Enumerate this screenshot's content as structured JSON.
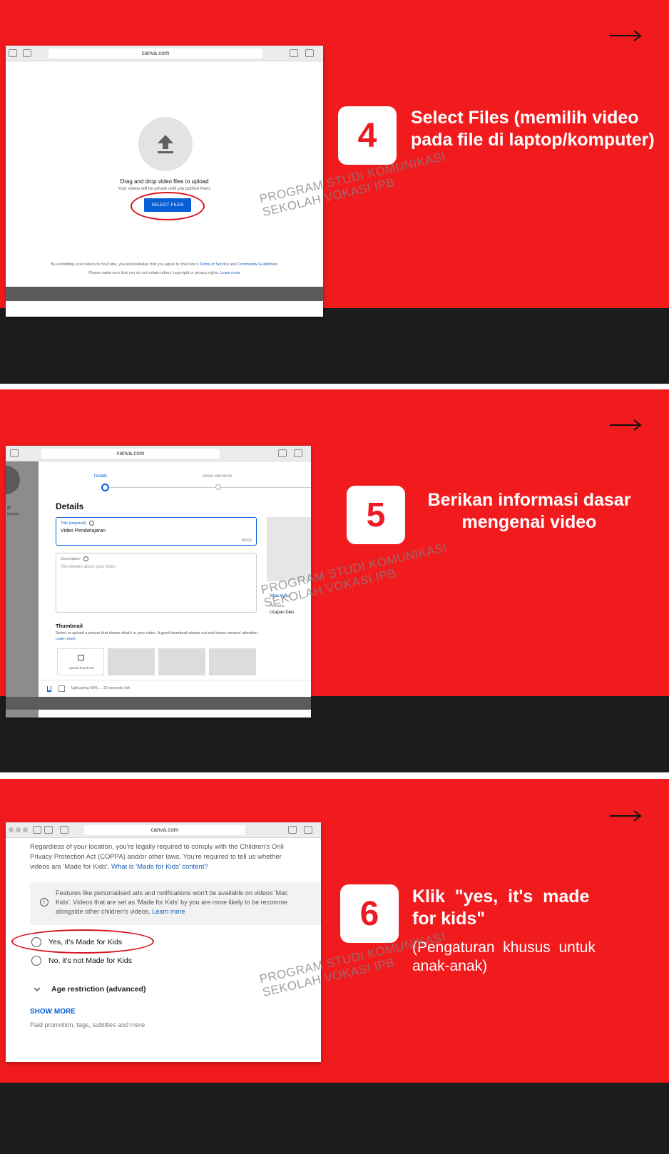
{
  "colors": {
    "accent_red": "#f11b1e",
    "dark": "#1d1c1c",
    "badge_text": "#ec1c24",
    "link_blue": "#1a5fb4",
    "button_blue": "#065fd4"
  },
  "watermark": {
    "line1": "PROGRAM STUDI KOMUNIKASI",
    "line2": "SEKOLAH VOKASI IPB"
  },
  "step4": {
    "number": "4",
    "title_line1": "Select Files (memilih video",
    "title_line2": "pada file di laptop/komputer)",
    "browser": {
      "url": "canva.com",
      "upload_icon": "upload-arrow-icon",
      "drag_text": "Drag and drop video files to upload",
      "private_text": "Your videos will be private until you publish them.",
      "select_button": "SELECT FILES",
      "terms_line1": "By submitting your videos to YouTube, you acknowledge that you agree to YouTube's",
      "terms_link1": "Terms of Service",
      "terms_and": "and",
      "terms_link2": "Community Guidelines.",
      "terms_line2": "Please make sure that you do not violate others' copyright or privacy rights.",
      "terms_link3": "Learn more"
    }
  },
  "step5": {
    "number": "5",
    "title_line1": "Berikan informasi dasar",
    "title_line2": "mengenai video",
    "browser": {
      "url": "canva.com",
      "tab_details": "Details",
      "tab_elements": "Video elements",
      "heading": "Details",
      "title_label": "Title (required)",
      "title_value": "Video Pembelajaran",
      "title_count": "18/100",
      "desc_label": "Description",
      "desc_placeholder": "Tell viewers about your video",
      "thumb_heading": "Thumbnail",
      "thumb_text": "Select or upload a picture that shows what's in your video. A good thumbnail stands out and draws viewers' attention.",
      "thumb_link": "Learn more",
      "upload_thumb": "Upload thumbnail",
      "side_link": "https://you",
      "side_filename_label": "Filename",
      "side_filename": "Ucapan Dies",
      "left_partial_1": "al",
      "left_partial_2": "tergaya",
      "status": "Uploading 58% ... 22 seconds left"
    }
  },
  "step6": {
    "number": "6",
    "title_line1": "Klik  \"yes,  it's  made",
    "title_line2": "for kids\"",
    "subtitle_line1": "(Pengaturan  khusus  untuk",
    "subtitle_line2": "anak-anak)",
    "browser": {
      "url": "canva.com",
      "para_line1": "Regardless of your location, you're legally required to comply with the Children's Onli",
      "para_line2": "Privacy Protection Act (COPPA) and/or other laws. You're required to tell us whether",
      "para_line3": "videos are 'Made for Kids'.",
      "para_link": "What is 'Made for Kids' content?",
      "info_line1": "Features like personalised ads and notifications won't be available on videos 'Mac",
      "info_line2": "Kids'. Videos that are set as 'Made for Kids' by you are more likely to be recomme",
      "info_line3": "alongside other children's videos.",
      "info_link": "Learn more",
      "radio_yes": "Yes, it's Made for Kids",
      "radio_no": "No, it's not Made for Kids",
      "age_restriction": "Age restriction (advanced)",
      "show_more": "SHOW MORE",
      "show_more_sub": "Paid promotion, tags, subtitles and more"
    }
  }
}
